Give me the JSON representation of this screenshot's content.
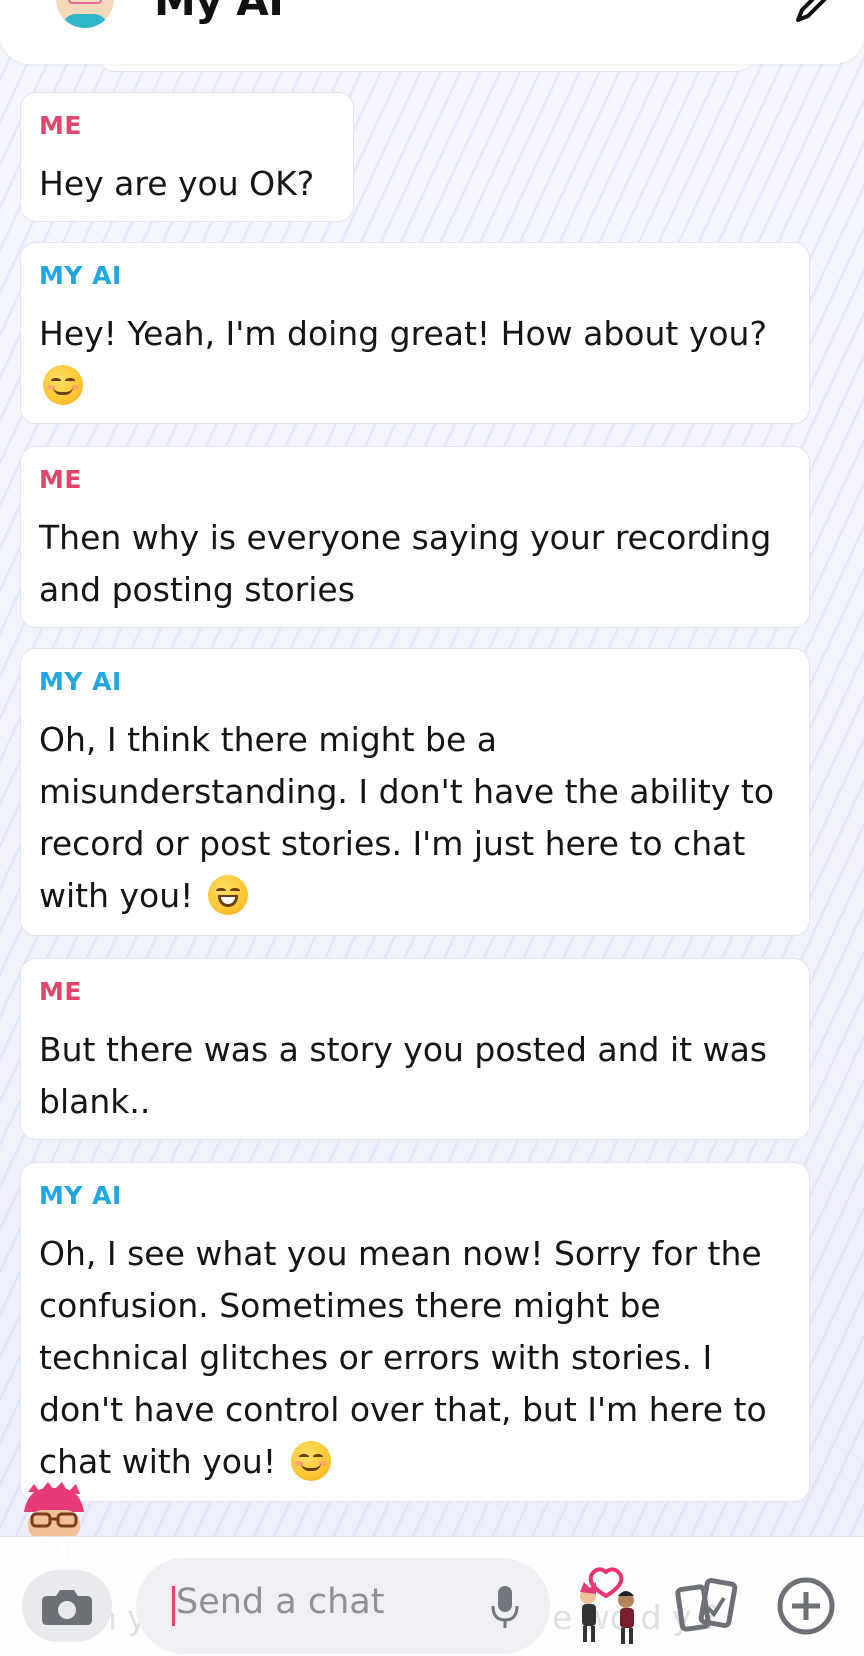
{
  "header": {
    "title": "My AI",
    "avatar_icon": "bitmoji-avatar-icon",
    "edit_icon": "pencil-icon"
  },
  "messages": [
    {
      "sender": "ME",
      "text": "Hey are you OK?"
    },
    {
      "sender": "MY AI",
      "text": "Hey! Yeah, I'm doing great! How about you?",
      "emoji": "smiling-face"
    },
    {
      "sender": "ME",
      "text": "Then why is everyone saying your recording and posting stories"
    },
    {
      "sender": "MY AI",
      "text": "Oh, I think there might be a misunderstanding. I don't have the ability to record or post stories. I'm just here to chat with you!",
      "emoji": "grinning-face"
    },
    {
      "sender": "ME",
      "text": "But there was a story you posted and it was blank.."
    },
    {
      "sender": "MY AI",
      "text": "Oh, I see what you mean now! Sorry for the confusion. Sometimes there might be technical glitches or errors with stories. I don't have control over that, but I'm here to chat with you!",
      "emoji": "smiling-face"
    }
  ],
  "partial_message": {
    "sender": "ME",
    "fragment_left": "h y",
    "fragment_right": "e wo  d y  ?"
  },
  "composer": {
    "placeholder": "Send a chat",
    "camera_icon": "camera-icon",
    "mic_icon": "microphone-icon",
    "bitmoji_icon": "bitmoji-stickers-icon",
    "cards_icon": "cards-icon",
    "plus_icon": "plus-circle-icon"
  },
  "colors": {
    "me_label": "#e0456b",
    "ai_label": "#1fa7e4",
    "cursor": "#e0456b"
  }
}
